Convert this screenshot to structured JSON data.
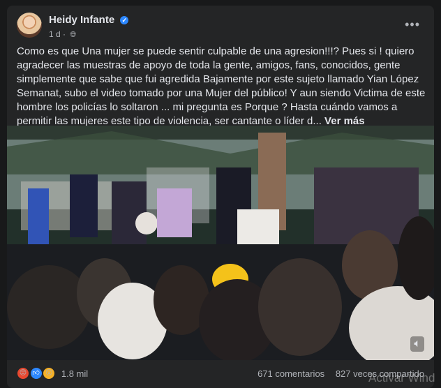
{
  "post": {
    "author": "Heidy Infante",
    "time": "1 d",
    "text": "Como es que Una mujer se puede sentir culpable de una agresion!!!? Pues si ! quiero agradecer las muestras de apoyo de toda la gente, amigos, fans, conocidos, gente simplemente que sabe que fui agredida Bajamente por este sujeto llamado Yian López Semanat, subo el video tomado por una Mujer del público! Y aun siendo Victima de este hombre los policías lo soltaron ... mi pregunta es Porque ? Hasta cuándo vamos a permitir las mujeres este tipo de violencia, ser cantante o líder d...",
    "see_more": "Ver más"
  },
  "reactions": {
    "count": "1.8 mil",
    "icons": [
      "angry-icon",
      "like-icon",
      "wow-icon"
    ]
  },
  "stats": {
    "comments": "671 comentarios",
    "shares": "827 veces compartido"
  },
  "watermark": "Activar Wind"
}
